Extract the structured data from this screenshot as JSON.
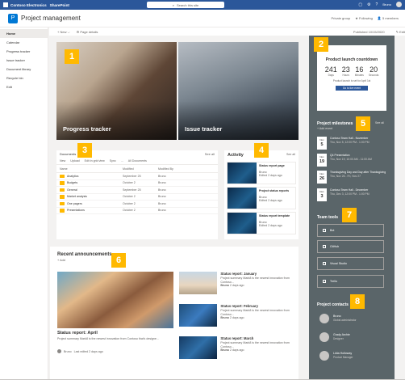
{
  "topbar": {
    "org": "Contoso Electronics",
    "app": "SharePoint",
    "search_placeholder": "Search this site",
    "user": "Bruno"
  },
  "site": {
    "logo_letter": "P",
    "title": "Project management",
    "privacy": "Private group",
    "follow": "Following",
    "members": "5 members"
  },
  "nav": {
    "items": [
      "Home",
      "Calendar",
      "Progress tracker",
      "Issue tracker",
      "Document library",
      "Recycle bin",
      "Edit"
    ],
    "active": 0
  },
  "commandbar": {
    "new": "New",
    "page_details": "Page details",
    "published": "Published 10/15/2020",
    "edit": "Edit"
  },
  "hero": {
    "tiles": [
      {
        "label": "Progress tracker",
        "badge": "1"
      },
      {
        "label": "Issue tracker",
        "badge": ""
      }
    ]
  },
  "badges": {
    "b2": "2",
    "b3": "3",
    "b4": "4",
    "b5": "5",
    "b6": "6",
    "b7": "7",
    "b8": "8"
  },
  "documents": {
    "title": "Documents",
    "see_all": "See all",
    "toolbar": [
      "New",
      "Upload",
      "Edit in grid view",
      "Sync",
      "...",
      "All Documents"
    ],
    "columns": [
      "Name",
      "Modified",
      "Modified By"
    ],
    "rows": [
      {
        "name": "Analytics",
        "modified": "September 25",
        "by": "Bruno"
      },
      {
        "name": "Budgets",
        "modified": "October 2",
        "by": "Bruno"
      },
      {
        "name": "General",
        "modified": "September 25",
        "by": "Bruno"
      },
      {
        "name": "Market analysis",
        "modified": "October 2",
        "by": "Bruno"
      },
      {
        "name": "One pagers",
        "modified": "October 2",
        "by": "Bruno"
      },
      {
        "name": "Presentations",
        "modified": "October 2",
        "by": "Bruno"
      }
    ]
  },
  "activity": {
    "title": "Activity",
    "see_all": "See all",
    "cards": [
      {
        "title": "Status report page",
        "user": "Bruno",
        "when": "Edited 2 days ago"
      },
      {
        "title": "Project status reports",
        "user": "Bruno",
        "when": "Edited 2 days ago"
      },
      {
        "title": "Status report template",
        "user": "Bruno",
        "when": "Edited 2 days ago"
      }
    ]
  },
  "announcements": {
    "title": "Recent announcements",
    "add": "Add",
    "main": {
      "title": "Status report: April",
      "desc": "Project summary Mark8 is the newest innovation from Contoso that's designe...",
      "by": "Bruno",
      "when": "Last edited 2 days ago"
    },
    "items": [
      {
        "title": "Status report: January",
        "desc": "Project summary Mark8 is the newest innovation from Contoso...",
        "by": "Bruno",
        "when": "2 days ago"
      },
      {
        "title": "Status report: February",
        "desc": "Project summary Mark8 is the newest innovation from Contoso...",
        "by": "Bruno",
        "when": "2 days ago"
      },
      {
        "title": "Status report: March",
        "desc": "Project summary Mark8 is the newest innovation from Contoso...",
        "by": "Bruno",
        "when": "2 days ago"
      }
    ]
  },
  "countdown": {
    "title": "Product launch countdown",
    "units": [
      {
        "v": "241",
        "l": "Days"
      },
      {
        "v": "23",
        "l": "Hours"
      },
      {
        "v": "16",
        "l": "Minutes"
      },
      {
        "v": "20",
        "l": "Seconds"
      }
    ],
    "msg": "Product launch is set for April 1st",
    "button": "Go to live event"
  },
  "milestones": {
    "title": "Project milestones",
    "see_all": "See all",
    "add": "Add event",
    "items": [
      {
        "mon": "Nov",
        "day": "5",
        "title": "Contoso Team Hall - November",
        "date": "Thu, Nov 5, 12:00 PM - 1:00 PM"
      },
      {
        "mon": "Nov",
        "day": "19",
        "title": "Q4 Presentation",
        "date": "Thu, Nov 19, 10:00 AM - 11:00 AM"
      },
      {
        "mon": "Nov",
        "day": "26",
        "title": "Thanksgiving Day and Day after Thanksgiving",
        "date": "Thu, Nov 26 - Fri, Nov 27"
      },
      {
        "mon": "Dec",
        "day": "3",
        "title": "Contoso Team Hall - December",
        "date": "Thu, Dec 3, 12:00 PM - 1:00 PM"
      }
    ]
  },
  "tools": {
    "title": "Team tools",
    "items": [
      "Bot",
      "GitHub",
      "Visual Studio",
      "Trello"
    ]
  },
  "contacts": {
    "title": "Project contacts",
    "items": [
      {
        "name": "Bruno",
        "role": "Global administrator"
      },
      {
        "name": "Grady Archie",
        "role": "Designer"
      },
      {
        "name": "Lidia Holloway",
        "role": "Product Manager"
      }
    ]
  }
}
